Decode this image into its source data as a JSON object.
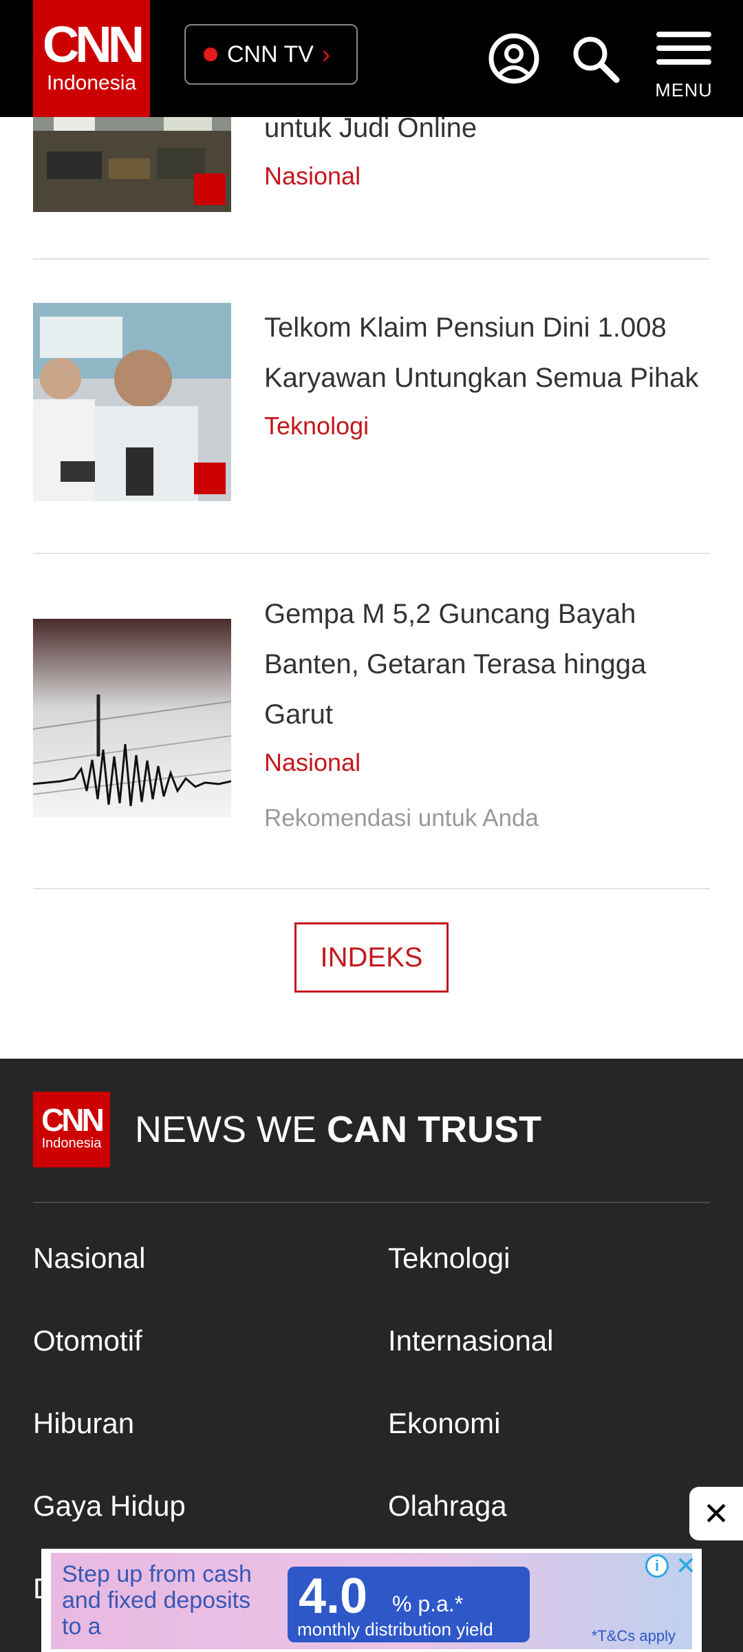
{
  "header": {
    "logo_main": "CNN",
    "logo_sub": "Indonesia",
    "cnntv_label": "CNN TV",
    "menu_label": "MENU"
  },
  "articles": [
    {
      "title": "untuk Judi Online",
      "category": "Nasional"
    },
    {
      "title": "Telkom Klaim Pensiun Dini 1.008 Karyawan Untungkan Semua Pihak",
      "category": "Teknologi"
    },
    {
      "title": "Gempa M 5,2 Guncang Bayah Banten, Getaran Terasa hingga Garut",
      "category": "Nasional",
      "recommendation": "Rekomendasi untuk Anda"
    }
  ],
  "indeks_label": "INDEKS",
  "footer": {
    "logo_main": "CNN",
    "logo_sub": "Indonesia",
    "tagline_light": "NEWS WE ",
    "tagline_bold": "CAN TRUST",
    "links": [
      "Nasional",
      "Teknologi",
      "Otomotif",
      "Internasional",
      "Hiburan",
      "Ekonomi",
      "Gaya Hidup",
      "Olahraga"
    ],
    "partial_link": "D"
  },
  "ad": {
    "text": "Step up from cash and fixed deposits to a",
    "rate": "4.0",
    "unit": "% p.a.*",
    "yield_label": "monthly distribution yield",
    "tcs": "*T&Cs apply",
    "info_glyph": "i",
    "close_glyph": "✕"
  },
  "ad_dismiss_glyph": "✕",
  "colors": {
    "brand_red": "#cc0000",
    "category_red": "#c4161c",
    "footer_bg": "#262626"
  }
}
